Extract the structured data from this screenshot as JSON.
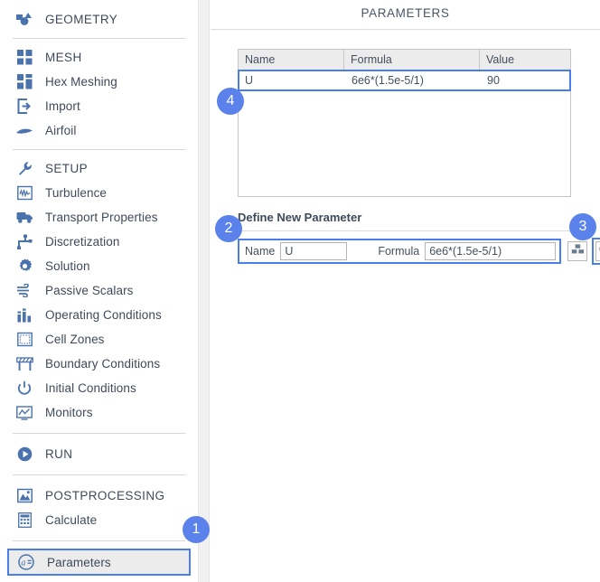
{
  "sidebar": {
    "groups": [
      {
        "id": "geometry",
        "items": [
          {
            "label": "GEOMETRY",
            "icon": "geometry-icon",
            "section": true
          }
        ]
      },
      {
        "id": "mesh",
        "items": [
          {
            "label": "MESH",
            "icon": "mesh-grid-icon",
            "section": true
          },
          {
            "label": "Hex Meshing",
            "icon": "hex-meshing-icon",
            "section": false
          },
          {
            "label": "Import",
            "icon": "import-icon",
            "section": false
          },
          {
            "label": "Airfoil",
            "icon": "airfoil-icon",
            "section": false
          }
        ]
      },
      {
        "id": "setup",
        "items": [
          {
            "label": "SETUP",
            "icon": "wrench-icon",
            "section": true
          },
          {
            "label": "Turbulence",
            "icon": "turbulence-icon",
            "section": false
          },
          {
            "label": "Transport Properties",
            "icon": "truck-icon",
            "section": false
          },
          {
            "label": "Discretization",
            "icon": "discretization-icon",
            "section": false
          },
          {
            "label": "Solution",
            "icon": "gear-icon",
            "section": false
          },
          {
            "label": "Passive Scalars",
            "icon": "wind-icon",
            "section": false
          },
          {
            "label": "Operating Conditions",
            "icon": "bar-chart-icon",
            "section": false
          },
          {
            "label": "Cell Zones",
            "icon": "cell-zones-icon",
            "section": false
          },
          {
            "label": "Boundary Conditions",
            "icon": "barrier-icon",
            "section": false
          },
          {
            "label": "Initial Conditions",
            "icon": "power-icon",
            "section": false
          },
          {
            "label": "Monitors",
            "icon": "monitor-chart-icon",
            "section": false
          }
        ]
      },
      {
        "id": "run",
        "items": [
          {
            "label": "RUN",
            "icon": "play-icon",
            "section": true
          }
        ]
      },
      {
        "id": "postprocessing",
        "items": [
          {
            "label": "POSTPROCESSING",
            "icon": "image-icon",
            "section": true
          },
          {
            "label": "Calculate",
            "icon": "calculator-icon",
            "section": false
          }
        ]
      }
    ],
    "selected_item": {
      "label": "Parameters",
      "icon": "at-equals-icon"
    }
  },
  "main": {
    "title": "PARAMETERS",
    "table": {
      "headers": [
        "Name",
        "Formula",
        "Value"
      ],
      "rows": [
        {
          "name": "U",
          "formula": "6e6*(1.5e-5/1)",
          "value": "90"
        }
      ]
    },
    "define_section": {
      "heading": "Define New Parameter",
      "name_label": "Name",
      "name_value": "U",
      "formula_label": "Formula",
      "formula_value": "6e6*(1.5e-5/1)",
      "stack_button_icon": "stacked-blocks-icon",
      "add_button_icon": "plus-circle-icon"
    }
  },
  "callouts": [
    {
      "number": "1",
      "target": "parameters-sidebar-item"
    },
    {
      "number": "2",
      "target": "define-new-parameter-fields"
    },
    {
      "number": "3",
      "target": "add-parameter-button"
    },
    {
      "number": "4",
      "target": "parameters-table-row"
    }
  ],
  "colors": {
    "accent": "#5b82ea",
    "highlight_border": "#4a7eea",
    "icon_blue": "#4a72ad",
    "text": "#3f4a5a",
    "table_header_bg": "#ececec"
  }
}
